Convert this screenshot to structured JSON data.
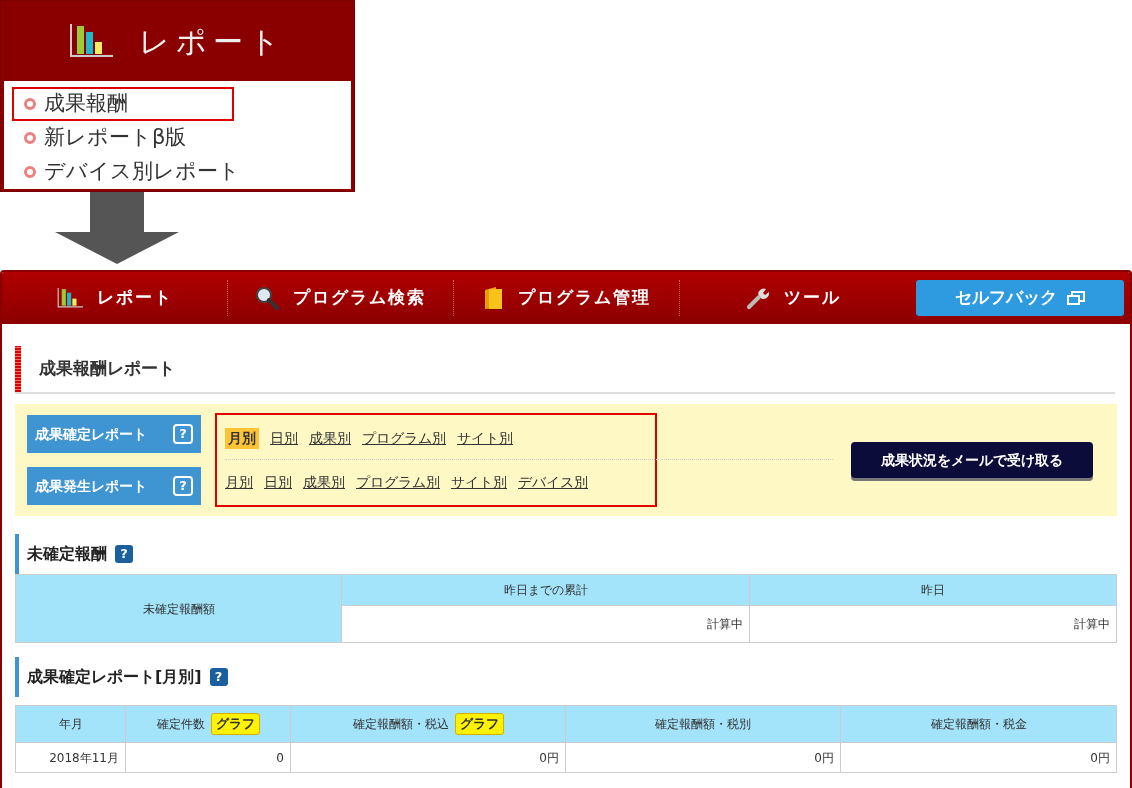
{
  "menu_popup": {
    "title": "レポート",
    "items": [
      {
        "label": "成果報酬",
        "selected": true
      },
      {
        "label": "新レポートβ版",
        "selected": false
      },
      {
        "label": "デバイス別レポート",
        "selected": false
      }
    ]
  },
  "nav": {
    "items": [
      {
        "label": "レポート",
        "kind": "report"
      },
      {
        "label": "プログラム検索",
        "kind": "search"
      },
      {
        "label": "プログラム管理",
        "kind": "folder"
      },
      {
        "label": "ツール",
        "kind": "tool"
      },
      {
        "label": "セルフバック",
        "kind": "button"
      }
    ]
  },
  "page_title": "成果報酬レポート",
  "report_links": {
    "highlighted": true,
    "rows": [
      {
        "label": "成果確定レポート",
        "help": "?",
        "links": [
          {
            "label": "月別",
            "selected": true
          },
          {
            "label": "日別",
            "selected": false
          },
          {
            "label": "成果別",
            "selected": false
          },
          {
            "label": "プログラム別",
            "selected": false
          },
          {
            "label": "サイト別",
            "selected": false
          }
        ]
      },
      {
        "label": "成果発生レポート",
        "help": "?",
        "links": [
          {
            "label": "月別",
            "selected": false
          },
          {
            "label": "日別",
            "selected": false
          },
          {
            "label": "成果別",
            "selected": false
          },
          {
            "label": "プログラム別",
            "selected": false
          },
          {
            "label": "サイト別",
            "selected": false
          },
          {
            "label": "デバイス別",
            "selected": false
          }
        ]
      }
    ],
    "mail_button": "成果状況をメールで受け取る"
  },
  "unconfirmed": {
    "title": "未確定報酬",
    "help": "?",
    "row_header": "未確定報酬額",
    "columns": [
      "昨日までの累計",
      "昨日"
    ],
    "values": [
      "計算中",
      "計算中"
    ]
  },
  "monthly": {
    "title": "成果確定レポート[月別]",
    "help": "?",
    "columns": [
      {
        "label": "年月"
      },
      {
        "label": "確定件数",
        "badge": "グラフ"
      },
      {
        "label": "確定報酬額・税込",
        "badge": "グラフ"
      },
      {
        "label": "確定報酬額・税別"
      },
      {
        "label": "確定報酬額・税金"
      }
    ],
    "rows": [
      [
        "2018年11月",
        "0",
        "0円",
        "0円",
        "0円"
      ]
    ]
  }
}
